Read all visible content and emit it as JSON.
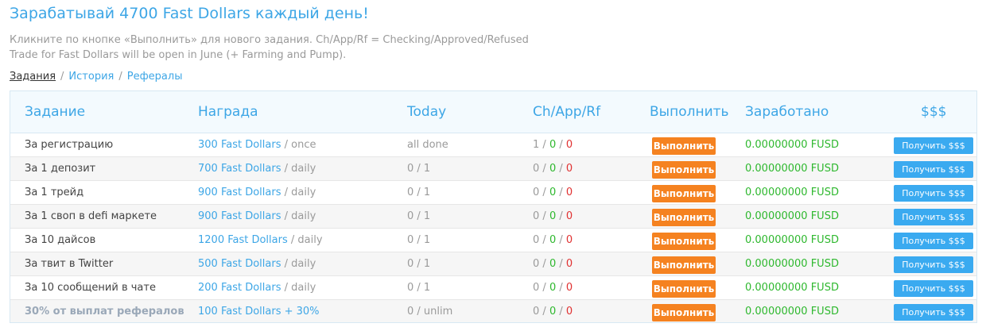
{
  "header": {
    "title": "Зарабатывай 4700 Fast Dollars каждый день!",
    "line1": "Кликните по кнопке «Выполнить» для нового задания. Ch/App/Rf = Checking/Approved/Refused",
    "line2": "Trade for Fast Dollars will be open in June (+ Farming and Pump)."
  },
  "breadcrumbs": {
    "tasks": "Задания",
    "history": "История",
    "referrals": "Рефералы",
    "separator": "/"
  },
  "table": {
    "columns": {
      "task": "Задание",
      "reward": "Награда",
      "today": "Today",
      "status": "Ch/App/Rf",
      "action": "Выполнить",
      "earned": "Заработано",
      "money": "$$$"
    },
    "rows": [
      {
        "task": "За регистрацию",
        "reward_amount": "300 Fast Dollars",
        "reward_period": " / once",
        "today": "all done",
        "ch": "1",
        "app": "0",
        "rf": "0",
        "action": "Выполнить",
        "earned": "0.00000000 FUSD",
        "get": "Получить $$$"
      },
      {
        "task": "За 1 депозит",
        "reward_amount": "700 Fast Dollars",
        "reward_period": " / daily",
        "today": "0 / 1",
        "ch": "0",
        "app": "0",
        "rf": "0",
        "action": "Выполнить",
        "earned": "0.00000000 FUSD",
        "get": "Получить $$$"
      },
      {
        "task": "За 1 трейд",
        "reward_amount": "900 Fast Dollars",
        "reward_period": " / daily",
        "today": "0 / 1",
        "ch": "0",
        "app": "0",
        "rf": "0",
        "action": "Выполнить",
        "earned": "0.00000000 FUSD",
        "get": "Получить $$$"
      },
      {
        "task": "За 1 своп в defi маркете",
        "reward_amount": "900 Fast Dollars",
        "reward_period": " / daily",
        "today": "0 / 1",
        "ch": "0",
        "app": "0",
        "rf": "0",
        "action": "Выполнить",
        "earned": "0.00000000 FUSD",
        "get": "Получить $$$"
      },
      {
        "task": "За 10 дайсов",
        "reward_amount": "1200 Fast Dollars",
        "reward_period": " / daily",
        "today": "0 / 1",
        "ch": "0",
        "app": "0",
        "rf": "0",
        "action": "Выполнить",
        "earned": "0.00000000 FUSD",
        "get": "Получить $$$"
      },
      {
        "task": "За твит в Twitter",
        "reward_amount": "500 Fast Dollars",
        "reward_period": " / daily",
        "today": "0 / 1",
        "ch": "0",
        "app": "0",
        "rf": "0",
        "action": "Выполнить",
        "earned": "0.00000000 FUSD",
        "get": "Получить $$$"
      },
      {
        "task": "За 10 сообщений в чате",
        "reward_amount": "200 Fast Dollars",
        "reward_period": " / daily",
        "today": "0 / 1",
        "ch": "0",
        "app": "0",
        "rf": "0",
        "action": "Выполнить",
        "earned": "0.00000000 FUSD",
        "get": "Получить $$$"
      },
      {
        "task": "30% от выплат рефералов",
        "reward_amount": "100 Fast Dollars + 30%",
        "reward_period": "",
        "today": "0 / unlim",
        "ch": "0",
        "app": "0",
        "rf": "0",
        "action": "Выполнить",
        "earned": "0.00000000 FUSD",
        "get": "Получить $$$"
      }
    ]
  },
  "colors": {
    "accent": "#3da6e6",
    "action_button": "#f58220",
    "get_button": "#3aaaf0",
    "approved": "#2eb82e",
    "refused": "#e03131"
  }
}
